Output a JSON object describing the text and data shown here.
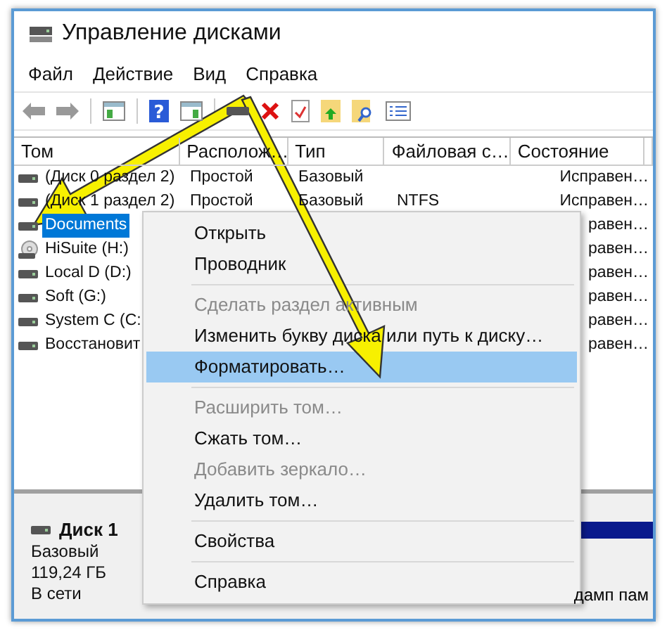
{
  "window": {
    "title": "Управление дисками"
  },
  "menu_bar": [
    "Файл",
    "Действие",
    "Вид",
    "Справка"
  ],
  "toolbar": {
    "help_glyph": "?"
  },
  "table": {
    "columns": [
      "Том",
      "Располож…",
      "Тип",
      "Файловая с…",
      "Состояние"
    ],
    "rows": [
      {
        "kind": "disk",
        "volume": "(Диск 0 раздел 2)",
        "layout": "Простой",
        "type": "Базовый",
        "status": "Исправен…",
        "selected": false
      },
      {
        "kind": "disk",
        "volume": "(Диск 1 раздел 2)",
        "layout": "Простой",
        "type": "Базовый",
        "fs": "NTFS",
        "status": "Исправен…",
        "selected": false
      },
      {
        "kind": "disk",
        "volume": "Documents",
        "status": "равен…",
        "selected": true
      },
      {
        "kind": "cd",
        "volume": "HiSuite (H:)",
        "status": "равен…",
        "selected": false
      },
      {
        "kind": "disk",
        "volume": "Local D (D:)",
        "status": "равен…",
        "selected": false
      },
      {
        "kind": "disk",
        "volume": "Soft (G:)",
        "status": "равен…",
        "selected": false
      },
      {
        "kind": "disk",
        "volume": "System C (C:",
        "status": "равен…",
        "selected": false
      },
      {
        "kind": "disk",
        "volume": "Восстановит",
        "status": "равен…",
        "selected": false
      }
    ]
  },
  "disk_pane": {
    "name": "Диск 1",
    "type": "Базовый",
    "size": "119,24 ГБ",
    "status": "В сети",
    "partition_note": "дамп пам"
  },
  "context_menu": {
    "items": [
      {
        "kind": "item",
        "label": "Открыть",
        "disabled": false,
        "selected": false
      },
      {
        "kind": "item",
        "label": "Проводник",
        "disabled": false,
        "selected": false
      },
      {
        "kind": "separator"
      },
      {
        "kind": "item",
        "label": "Сделать раздел активным",
        "disabled": true,
        "selected": false
      },
      {
        "kind": "item",
        "label": "Изменить букву диска или путь к диску…",
        "disabled": false,
        "selected": false
      },
      {
        "kind": "item",
        "label": "Форматировать…",
        "disabled": false,
        "selected": true
      },
      {
        "kind": "separator"
      },
      {
        "kind": "item",
        "label": "Расширить том…",
        "disabled": true,
        "selected": false
      },
      {
        "kind": "item",
        "label": "Сжать том…",
        "disabled": false,
        "selected": false
      },
      {
        "kind": "item",
        "label": "Добавить зеркало…",
        "disabled": true,
        "selected": false
      },
      {
        "kind": "item",
        "label": "Удалить том…",
        "disabled": false,
        "selected": false
      },
      {
        "kind": "separator"
      },
      {
        "kind": "item",
        "label": "Свойства",
        "disabled": false,
        "selected": false
      },
      {
        "kind": "separator"
      },
      {
        "kind": "item",
        "label": "Справка",
        "disabled": false,
        "selected": false
      }
    ]
  }
}
